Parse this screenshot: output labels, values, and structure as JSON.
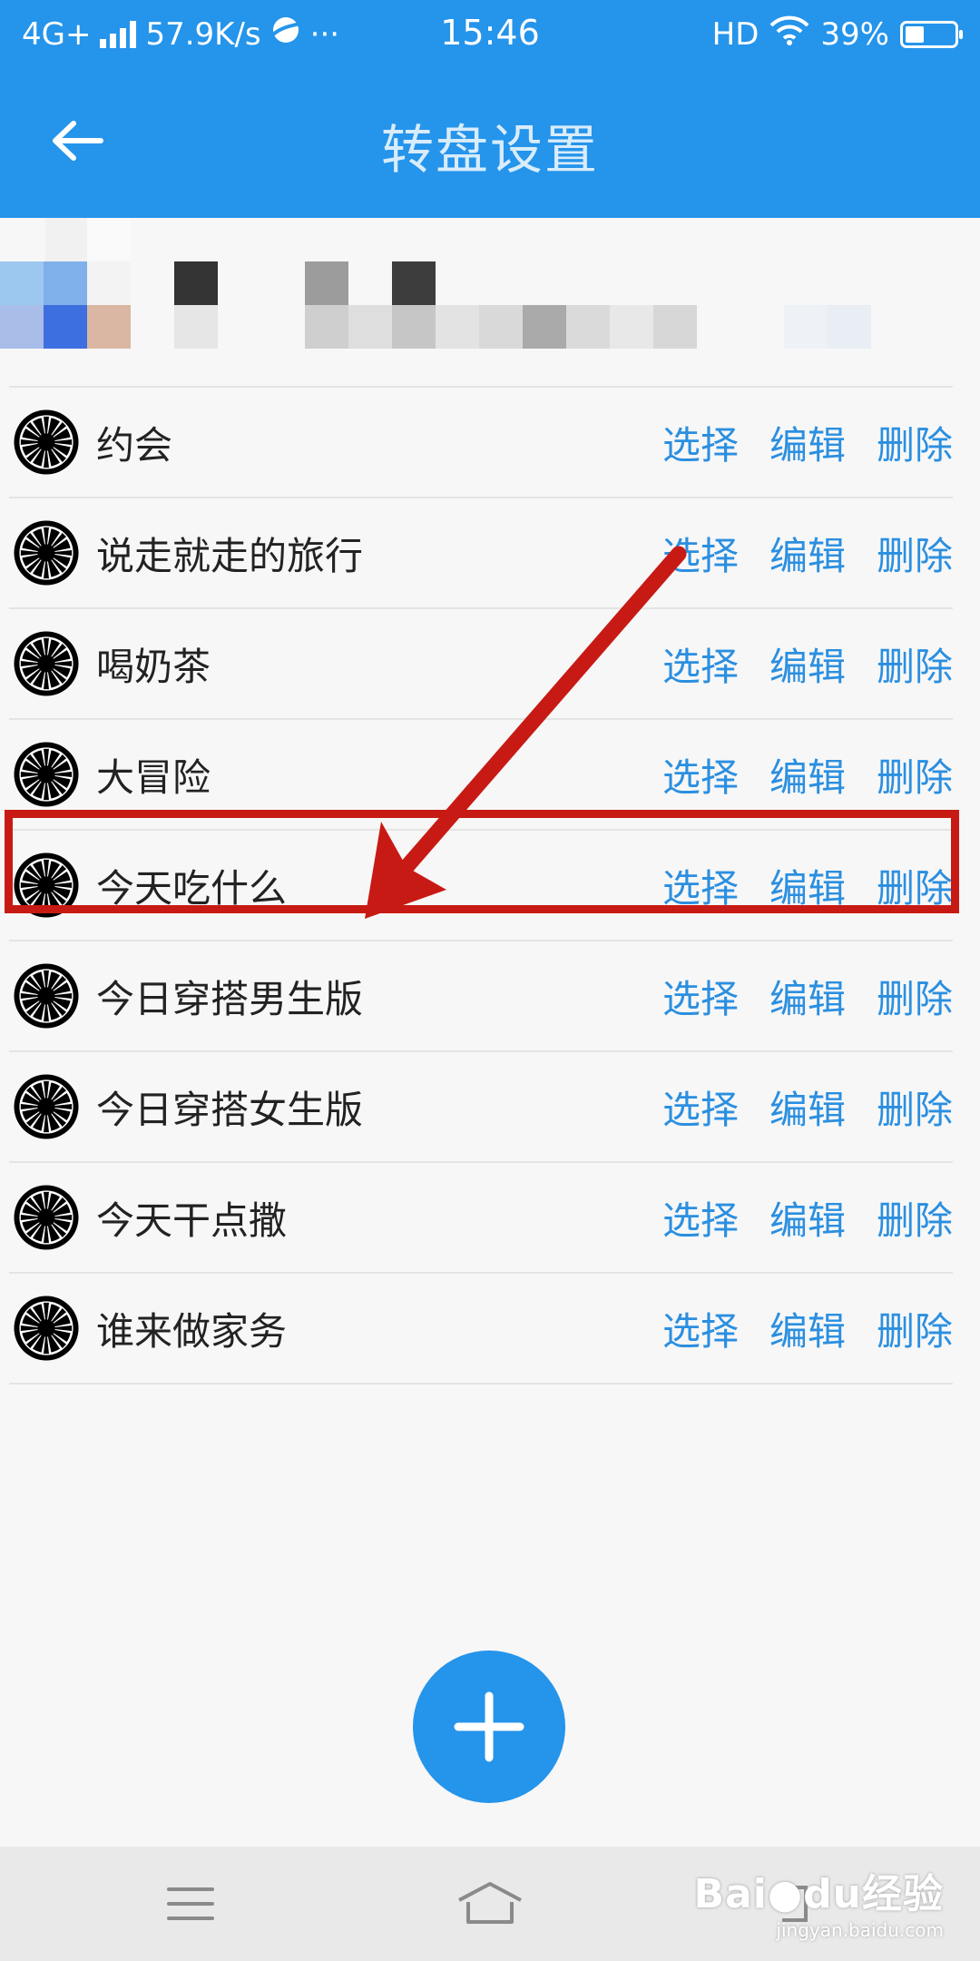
{
  "status_bar": {
    "network": "4G+",
    "speed": "57.9K/s",
    "more": "···",
    "time": "15:46",
    "hd": "HD",
    "battery_text": "39%",
    "battery_level": 0.39
  },
  "header": {
    "title": "转盘设置"
  },
  "actions": {
    "select": "选择",
    "edit": "编辑",
    "delete": "删除"
  },
  "wheels": [
    {
      "name": "约会"
    },
    {
      "name": "说走就走的旅行"
    },
    {
      "name": "喝奶茶"
    },
    {
      "name": "大冒险"
    },
    {
      "name": "今天吃什么"
    },
    {
      "name": "今日穿搭男生版"
    },
    {
      "name": "今日穿搭女生版"
    },
    {
      "name": "今天干点撒"
    },
    {
      "name": "谁来做家务"
    }
  ],
  "highlighted_row": "今天吃什么",
  "watermark": {
    "main": "Bai●du经验",
    "sub": "jingyan.baidu.com"
  },
  "colors": {
    "accent": "#2594eb",
    "action_text": "#2b8fe0",
    "annotation_red": "#c81a14"
  }
}
